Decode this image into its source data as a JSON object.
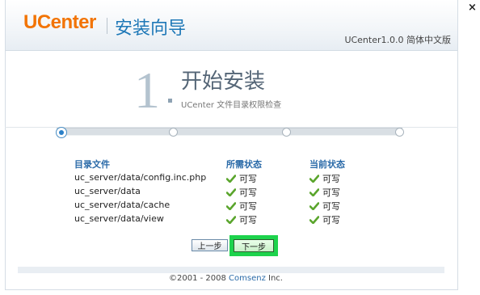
{
  "header": {
    "logo": "UCenter",
    "title": "安装向导",
    "version": "UCenter1.0.0 简体中文版"
  },
  "close_label": "×",
  "step": {
    "number": "1",
    "title": "开始安装",
    "subtitle": "UCenter 文件目录权限检查"
  },
  "progress": {
    "steps_total": 4,
    "current_step": 1
  },
  "table": {
    "headers": [
      "目录文件",
      "所需状态",
      "当前状态"
    ],
    "rows": [
      {
        "path": "uc_server/data/config.inc.php",
        "required": "可写",
        "current": "可写"
      },
      {
        "path": "uc_server/data",
        "required": "可写",
        "current": "可写"
      },
      {
        "path": "uc_server/data/cache",
        "required": "可写",
        "current": "可写"
      },
      {
        "path": "uc_server/data/view",
        "required": "可写",
        "current": "可写"
      }
    ]
  },
  "buttons": {
    "prev": "上一步",
    "next": "下一步"
  },
  "footer": {
    "prefix": "©2001 - 2008 ",
    "brand": "Comsenz",
    "suffix": " Inc."
  },
  "colors": {
    "logo": "#f27405",
    "title": "#1e78b7",
    "header_text": "#2a6aa8",
    "check": "#5aa52c",
    "highlight": "#1dd34c"
  }
}
